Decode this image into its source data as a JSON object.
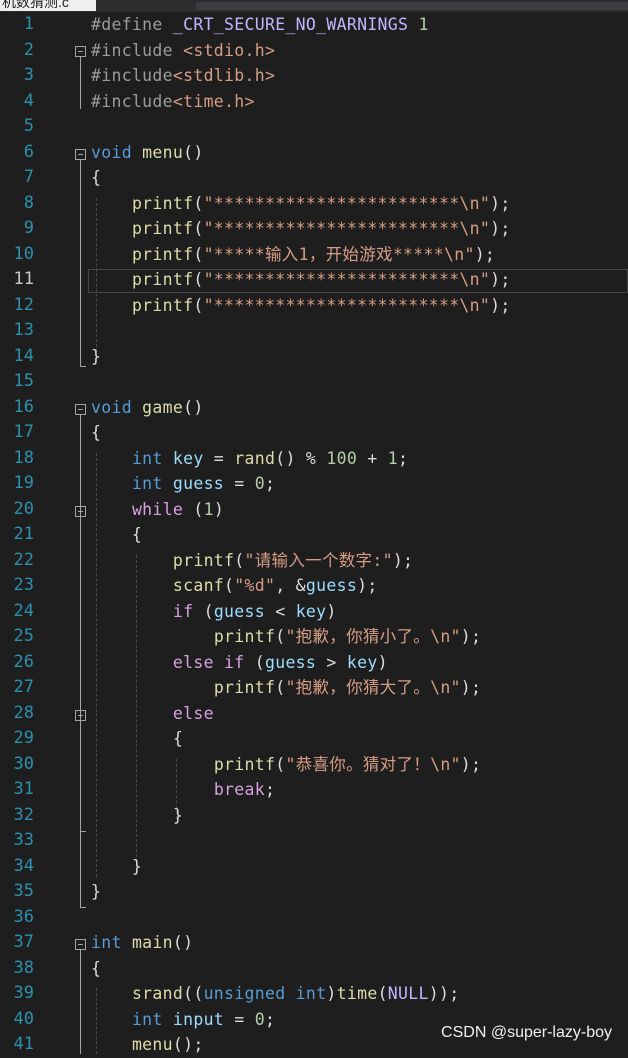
{
  "titlebar": {
    "tab_title": "机数猜测.c"
  },
  "editor": {
    "active_line": 11,
    "lines": [
      [
        [
          "pp",
          "#define "
        ],
        [
          "mac",
          "_CRT_SECURE_NO_WARNINGS"
        ],
        [
          "num",
          " 1"
        ]
      ],
      [
        [
          "pp",
          "#include "
        ],
        [
          "str",
          "<stdio.h>"
        ]
      ],
      [
        [
          "pp",
          "#include"
        ],
        [
          "str",
          "<stdlib.h>"
        ]
      ],
      [
        [
          "pp",
          "#include"
        ],
        [
          "str",
          "<time.h>"
        ]
      ],
      [],
      [
        [
          "kw",
          "void"
        ],
        [
          "p",
          " "
        ],
        [
          "fn",
          "menu"
        ],
        [
          "p",
          "()"
        ]
      ],
      [
        [
          "p",
          "{"
        ]
      ],
      [
        [
          "p",
          "    "
        ],
        [
          "fn",
          "printf"
        ],
        [
          "p",
          "("
        ],
        [
          "str",
          "\"************************\\n\""
        ],
        [
          "p",
          ");"
        ]
      ],
      [
        [
          "p",
          "    "
        ],
        [
          "fn",
          "printf"
        ],
        [
          "p",
          "("
        ],
        [
          "str",
          "\"************************\\n\""
        ],
        [
          "p",
          ");"
        ]
      ],
      [
        [
          "p",
          "    "
        ],
        [
          "fn",
          "printf"
        ],
        [
          "p",
          "("
        ],
        [
          "str",
          "\"*****输入1，开始游戏*****\\n\""
        ],
        [
          "p",
          ");"
        ]
      ],
      [
        [
          "p",
          "    "
        ],
        [
          "fn",
          "printf"
        ],
        [
          "p",
          "("
        ],
        [
          "str",
          "\"************************\\n\""
        ],
        [
          "p",
          ");"
        ]
      ],
      [
        [
          "p",
          "    "
        ],
        [
          "fn",
          "printf"
        ],
        [
          "p",
          "("
        ],
        [
          "str",
          "\"************************\\n\""
        ],
        [
          "p",
          ");"
        ]
      ],
      [],
      [
        [
          "p",
          "}"
        ]
      ],
      [],
      [
        [
          "kw",
          "void"
        ],
        [
          "p",
          " "
        ],
        [
          "fn",
          "game"
        ],
        [
          "p",
          "()"
        ]
      ],
      [
        [
          "p",
          "{"
        ]
      ],
      [
        [
          "p",
          "    "
        ],
        [
          "kw",
          "int"
        ],
        [
          "p",
          " "
        ],
        [
          "var",
          "key"
        ],
        [
          "p",
          " = "
        ],
        [
          "fn",
          "rand"
        ],
        [
          "p",
          "() % "
        ],
        [
          "num",
          "100"
        ],
        [
          "p",
          " + "
        ],
        [
          "num",
          "1"
        ],
        [
          "p",
          ";"
        ]
      ],
      [
        [
          "p",
          "    "
        ],
        [
          "kw",
          "int"
        ],
        [
          "p",
          " "
        ],
        [
          "var",
          "guess"
        ],
        [
          "p",
          " = "
        ],
        [
          "num",
          "0"
        ],
        [
          "p",
          ";"
        ]
      ],
      [
        [
          "p",
          "    "
        ],
        [
          "ctl",
          "while"
        ],
        [
          "p",
          " ("
        ],
        [
          "num",
          "1"
        ],
        [
          "p",
          ")"
        ]
      ],
      [
        [
          "p",
          "    {"
        ]
      ],
      [
        [
          "p",
          "        "
        ],
        [
          "fn",
          "printf"
        ],
        [
          "p",
          "("
        ],
        [
          "str",
          "\"请输入一个数字:\""
        ],
        [
          "p",
          ");"
        ]
      ],
      [
        [
          "p",
          "        "
        ],
        [
          "fn",
          "scanf"
        ],
        [
          "p",
          "("
        ],
        [
          "str",
          "\"%d\""
        ],
        [
          "p",
          ", &"
        ],
        [
          "var",
          "guess"
        ],
        [
          "p",
          ");"
        ]
      ],
      [
        [
          "p",
          "        "
        ],
        [
          "ctl",
          "if"
        ],
        [
          "p",
          " ("
        ],
        [
          "var",
          "guess"
        ],
        [
          "p",
          " < "
        ],
        [
          "var",
          "key"
        ],
        [
          "p",
          ")"
        ]
      ],
      [
        [
          "p",
          "            "
        ],
        [
          "fn",
          "printf"
        ],
        [
          "p",
          "("
        ],
        [
          "str",
          "\"抱歉，你猜小了。\\n\""
        ],
        [
          "p",
          ");"
        ]
      ],
      [
        [
          "p",
          "        "
        ],
        [
          "ctl",
          "else if"
        ],
        [
          "p",
          " ("
        ],
        [
          "var",
          "guess"
        ],
        [
          "p",
          " > "
        ],
        [
          "var",
          "key"
        ],
        [
          "p",
          ")"
        ]
      ],
      [
        [
          "p",
          "            "
        ],
        [
          "fn",
          "printf"
        ],
        [
          "p",
          "("
        ],
        [
          "str",
          "\"抱歉，你猜大了。\\n\""
        ],
        [
          "p",
          ");"
        ]
      ],
      [
        [
          "p",
          "        "
        ],
        [
          "ctl",
          "else"
        ]
      ],
      [
        [
          "p",
          "        {"
        ]
      ],
      [
        [
          "p",
          "            "
        ],
        [
          "fn",
          "printf"
        ],
        [
          "p",
          "("
        ],
        [
          "str",
          "\"恭喜你。猜对了！\\n\""
        ],
        [
          "p",
          ");"
        ]
      ],
      [
        [
          "p",
          "            "
        ],
        [
          "ctl",
          "break"
        ],
        [
          "p",
          ";"
        ]
      ],
      [
        [
          "p",
          "        }"
        ]
      ],
      [],
      [
        [
          "p",
          "    }"
        ]
      ],
      [
        [
          "p",
          "}"
        ]
      ],
      [],
      [
        [
          "kw",
          "int"
        ],
        [
          "p",
          " "
        ],
        [
          "fn",
          "main"
        ],
        [
          "p",
          "()"
        ]
      ],
      [
        [
          "p",
          "{"
        ]
      ],
      [
        [
          "p",
          "    "
        ],
        [
          "fn",
          "srand"
        ],
        [
          "p",
          "(("
        ],
        [
          "kw",
          "unsigned int"
        ],
        [
          "p",
          ")"
        ],
        [
          "fn",
          "time"
        ],
        [
          "p",
          "("
        ],
        [
          "mac",
          "NULL"
        ],
        [
          "p",
          "));"
        ]
      ],
      [
        [
          "p",
          "    "
        ],
        [
          "kw",
          "int"
        ],
        [
          "p",
          " "
        ],
        [
          "var",
          "input"
        ],
        [
          "p",
          " = "
        ],
        [
          "num",
          "0"
        ],
        [
          "p",
          ";"
        ]
      ],
      [
        [
          "p",
          "    "
        ],
        [
          "fn",
          "menu"
        ],
        [
          "p",
          "();"
        ]
      ]
    ]
  },
  "watermark": {
    "text": "CSDN @super-lazy-boy"
  }
}
